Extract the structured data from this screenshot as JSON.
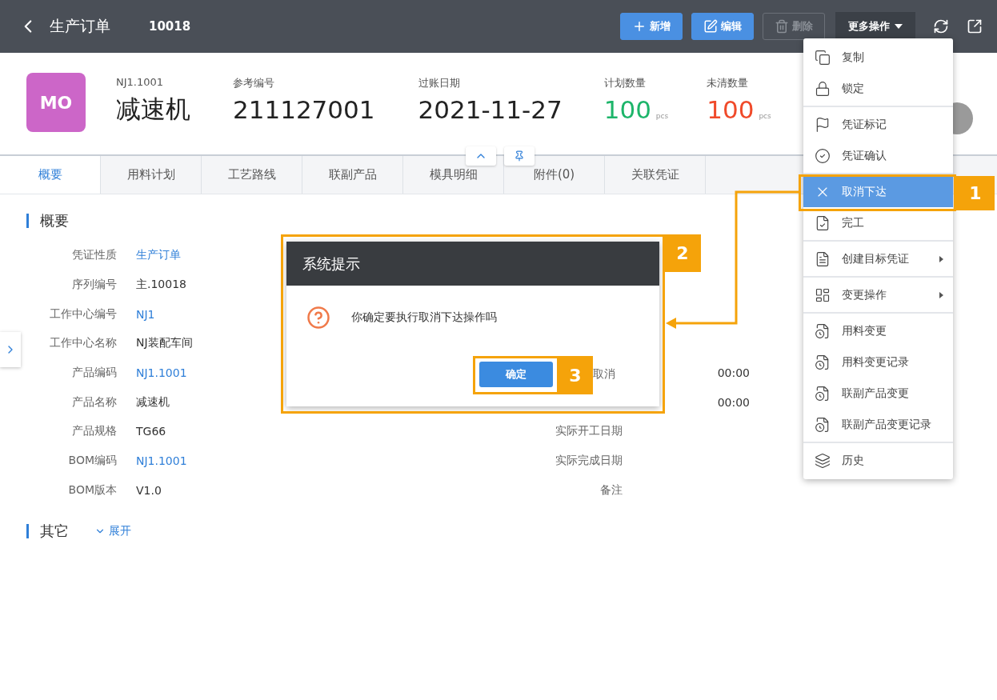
{
  "header": {
    "title": "生产订单",
    "number": "10018",
    "buttons": [
      {
        "label": "新增",
        "disabled": false
      },
      {
        "label": "编辑",
        "disabled": false
      },
      {
        "label": "删除",
        "disabled": true
      }
    ],
    "more": {
      "label": "更多操作",
      "expanded": true
    }
  },
  "summary": {
    "badge": "MO",
    "fields": [
      {
        "label": "NJ1.1001",
        "value": "减速机"
      },
      {
        "label": "参考编号",
        "value": "211127001"
      },
      {
        "label": "过账日期",
        "value": "2021-11-27"
      },
      {
        "label": "计划数量",
        "value": "100",
        "unit": "pcs",
        "color": "#1db56a"
      },
      {
        "label": "未清数量",
        "value": "100",
        "unit": "pcs",
        "color": "#f04a2a"
      }
    ]
  },
  "tabs": [
    {
      "label": "概要",
      "selected": true
    },
    {
      "label": "用料计划",
      "selected": false
    },
    {
      "label": "工艺路线",
      "selected": false
    },
    {
      "label": "联副产品",
      "selected": false
    },
    {
      "label": "模具明细",
      "selected": false
    },
    {
      "label": "附件(0)",
      "selected": false
    },
    {
      "label": "关联凭证",
      "selected": false
    }
  ],
  "section": {
    "title": "概要",
    "fields": [
      {
        "label": "凭证性质",
        "value": "生产订单",
        "kind": "link"
      },
      {
        "label": "序列编号",
        "value": "主.10018",
        "kind": "text"
      },
      {
        "label": "工作中心编号",
        "value": "NJ1",
        "kind": "link"
      },
      {
        "label": "工作中心名称",
        "value": "NJ装配车间",
        "kind": "text"
      },
      {
        "label": "产品编码",
        "value": "NJ1.1001",
        "kind": "link"
      },
      {
        "label": "产品名称",
        "value": "减速机",
        "kind": "text"
      },
      {
        "label": "产品规格",
        "value": "TG66",
        "kind": "text"
      },
      {
        "label": "BOM编码",
        "value": "NJ1.1001",
        "kind": "link"
      },
      {
        "label": "BOM版本",
        "value": "V1.0",
        "kind": "text"
      }
    ],
    "right_fields": [
      {
        "value": "00:00",
        "kind": "clipped"
      },
      {
        "value": "00:00",
        "kind": "clipped"
      },
      {
        "label": "实际开工日期"
      },
      {
        "label": "实际完成日期"
      },
      {
        "label": "备注"
      }
    ]
  },
  "other_section": {
    "title": "其它",
    "toggle": "展开",
    "expanded": false
  },
  "dialog": {
    "title": "系统提示",
    "message": "你确定要执行取消下达操作吗",
    "ok": "确定",
    "cancel": "取消"
  },
  "menu": {
    "groups": [
      [
        {
          "label": "复制",
          "selected": false,
          "submenu": false
        },
        {
          "label": "锁定",
          "selected": false,
          "submenu": false
        }
      ],
      [
        {
          "label": "凭证标记",
          "selected": false,
          "submenu": false
        },
        {
          "label": "凭证确认",
          "selected": false,
          "submenu": false
        }
      ],
      [
        {
          "label": "取消下达",
          "selected": true,
          "submenu": false
        },
        {
          "label": "完工",
          "selected": false,
          "submenu": false
        }
      ],
      [
        {
          "label": "创建目标凭证",
          "selected": false,
          "submenu": true
        }
      ],
      [
        {
          "label": "变更操作",
          "selected": false,
          "submenu": true
        }
      ],
      [
        {
          "label": "用料变更",
          "selected": false,
          "submenu": false
        },
        {
          "label": "用料变更记录",
          "selected": false,
          "submenu": false
        },
        {
          "label": "联副产品变更",
          "selected": false,
          "submenu": false
        },
        {
          "label": "联副产品变更记录",
          "selected": false,
          "submenu": false
        }
      ],
      [
        {
          "label": "历史",
          "selected": false,
          "submenu": false
        }
      ]
    ]
  },
  "annotations": [
    "1",
    "2",
    "3"
  ]
}
